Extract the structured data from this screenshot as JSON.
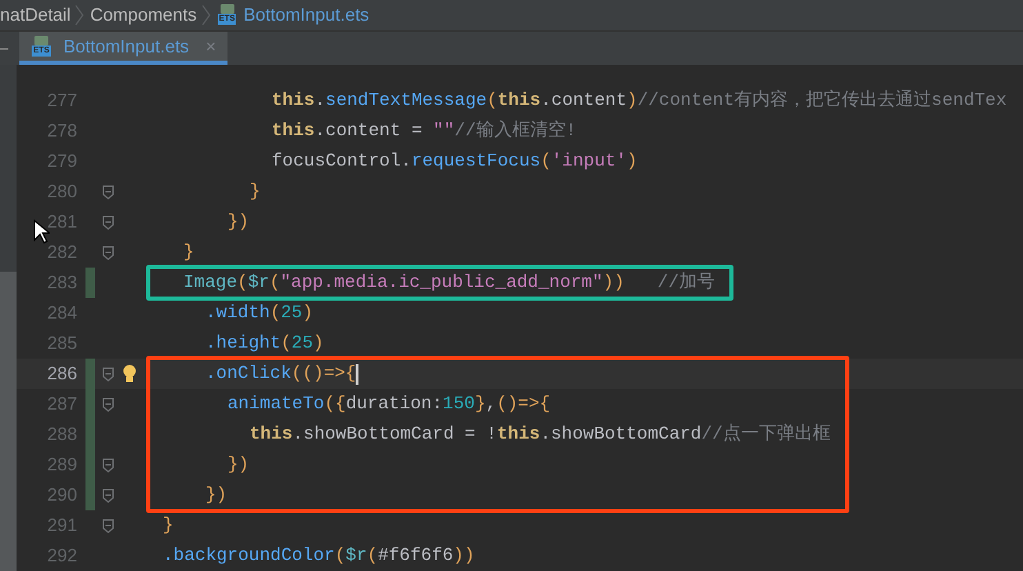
{
  "breadcrumb": [
    {
      "label": "natDetail"
    },
    {
      "label": "Compoments"
    },
    {
      "label": "BottomInput.ets",
      "icon_label": "ETS"
    }
  ],
  "tabs": [
    {
      "label": "BottomInput.ets",
      "selected": true,
      "close": "×",
      "icon_label": "ETS"
    }
  ],
  "blocks": [
    {
      "lines": [
        {
          "number": "277",
          "kind": "indent12",
          "fold": false,
          "changed": false,
          "current": false,
          "bulb": false,
          "tokens": [
            {
              "kind": "kw",
              "t": "this"
            },
            {
              "kind": "pun",
              "t": "."
            },
            {
              "kind": "fn",
              "t": "sendTextMessage"
            },
            {
              "kind": "brk",
              "t": "("
            },
            {
              "kind": "kw",
              "t": "this"
            },
            {
              "kind": "pun",
              "t": "."
            },
            {
              "kind": "plain",
              "t": "content"
            },
            {
              "kind": "brk",
              "t": ")"
            },
            {
              "kind": "cmt",
              "t": "//content有内容，把它传出去通过sendTex"
            }
          ]
        },
        {
          "number": "278",
          "kind": "indent12",
          "fold": false,
          "changed": false,
          "current": false,
          "bulb": false,
          "tokens": [
            {
              "kind": "kw",
              "t": "this"
            },
            {
              "kind": "pun",
              "t": "."
            },
            {
              "kind": "plain",
              "t": "content = "
            },
            {
              "kind": "str",
              "t": "\"\""
            },
            {
              "kind": "cmt",
              "t": "//输入框清空!"
            }
          ]
        },
        {
          "number": "279",
          "kind": "indent12",
          "fold": false,
          "changed": false,
          "current": false,
          "bulb": false,
          "tokens": [
            {
              "kind": "plain",
              "t": "focusControl"
            },
            {
              "kind": "pun",
              "t": "."
            },
            {
              "kind": "fn",
              "t": "requestFocus"
            },
            {
              "kind": "brk",
              "t": "("
            },
            {
              "kind": "str",
              "t": "'input'"
            },
            {
              "kind": "brk",
              "t": ")"
            }
          ]
        },
        {
          "number": "280",
          "kind": "indent10",
          "fold": true,
          "changed": false,
          "current": false,
          "bulb": false,
          "tokens": [
            {
              "kind": "brk",
              "t": "}"
            }
          ]
        },
        {
          "number": "281",
          "kind": "indent8",
          "fold": true,
          "changed": false,
          "current": false,
          "bulb": false,
          "tokens": [
            {
              "kind": "brk",
              "t": "})"
            }
          ]
        },
        {
          "number": "282",
          "kind": "indent4",
          "fold": true,
          "changed": false,
          "current": false,
          "bulb": false,
          "tokens": [
            {
              "kind": "brk",
              "t": "}"
            }
          ]
        }
      ]
    },
    {
      "color": "#1db99a",
      "lines": [
        {
          "number": "283",
          "kind": "indent4",
          "fold": false,
          "changed": true,
          "current": false,
          "bulb": false,
          "tokens": [
            {
              "kind": "cls",
              "t": "Image"
            },
            {
              "kind": "brk",
              "t": "("
            },
            {
              "kind": "cls",
              "t": "$r"
            },
            {
              "kind": "brk",
              "t": "("
            },
            {
              "kind": "str",
              "t": "\"app.media.ic_public_add_norm\""
            },
            {
              "kind": "brk",
              "t": "))"
            },
            {
              "kind": "spaced_cmt",
              "t": "//加号"
            }
          ]
        }
      ]
    },
    {
      "lines": [
        {
          "number": "284",
          "kind": "indent6",
          "fold": false,
          "changed": false,
          "current": false,
          "bulb": false,
          "tokens": [
            {
              "kind": "fn",
              "t": ".width"
            },
            {
              "kind": "brk",
              "t": "("
            },
            {
              "kind": "num",
              "t": "25"
            },
            {
              "kind": "brk",
              "t": ")"
            }
          ]
        },
        {
          "number": "285",
          "kind": "indent6",
          "fold": false,
          "changed": false,
          "current": false,
          "bulb": false,
          "tokens": [
            {
              "kind": "fn",
              "t": ".height"
            },
            {
              "kind": "brk",
              "t": "("
            },
            {
              "kind": "num",
              "t": "25"
            },
            {
              "kind": "brk",
              "t": ")"
            }
          ]
        }
      ]
    },
    {
      "color": "#ff4013",
      "lines": [
        {
          "number": "286",
          "kind": "indent6",
          "fold": true,
          "changed": true,
          "current": true,
          "bulb": true,
          "tokens": [
            {
              "kind": "fn",
              "t": ".onClick"
            },
            {
              "kind": "brk",
              "t": "(()=>{"
            }
          ]
        },
        {
          "number": "287",
          "kind": "indent8",
          "fold": true,
          "changed": true,
          "current": false,
          "bulb": false,
          "tokens": [
            {
              "kind": "fn",
              "t": "animateTo"
            },
            {
              "kind": "brk",
              "t": "({"
            },
            {
              "kind": "plain",
              "t": "duration:"
            },
            {
              "kind": "num",
              "t": "150"
            },
            {
              "kind": "brk",
              "t": "}"
            },
            {
              "kind": "pun",
              "t": ","
            },
            {
              "kind": "brk",
              "t": "()=>{"
            }
          ]
        },
        {
          "number": "288",
          "kind": "indent10",
          "fold": false,
          "changed": true,
          "current": false,
          "bulb": false,
          "tokens": [
            {
              "kind": "kw",
              "t": "this"
            },
            {
              "kind": "pun",
              "t": "."
            },
            {
              "kind": "plain",
              "t": "showBottomCard = !"
            },
            {
              "kind": "kw",
              "t": "this"
            },
            {
              "kind": "pun",
              "t": "."
            },
            {
              "kind": "plain",
              "t": "showBottomCard"
            },
            {
              "kind": "cmt",
              "t": "//点一下弹出框"
            }
          ]
        },
        {
          "number": "289",
          "kind": "indent8",
          "fold": true,
          "changed": true,
          "current": false,
          "bulb": false,
          "tokens": [
            {
              "kind": "brk",
              "t": "})"
            }
          ]
        },
        {
          "number": "290",
          "kind": "indent6",
          "fold": true,
          "changed": true,
          "current": false,
          "bulb": false,
          "tokens": [
            {
              "kind": "brk",
              "t": "})"
            }
          ]
        }
      ]
    },
    {
      "lines": [
        {
          "number": "291",
          "kind": "indent2",
          "fold": true,
          "changed": false,
          "current": false,
          "bulb": false,
          "tokens": [
            {
              "kind": "brk",
              "t": "}"
            }
          ]
        },
        {
          "number": "292",
          "kind": "indent2",
          "fold": false,
          "changed": false,
          "current": false,
          "bulb": false,
          "tokens": [
            {
              "kind": "fn",
              "t": ".backgroundColor"
            },
            {
              "kind": "brk",
              "t": "("
            },
            {
              "kind": "cls",
              "t": "$r"
            },
            {
              "kind": "brk",
              "t": "("
            },
            {
              "kind": "plain",
              "t": "#f6f6f6"
            },
            {
              "kind": "brk",
              "t": "))"
            }
          ]
        }
      ]
    }
  ]
}
